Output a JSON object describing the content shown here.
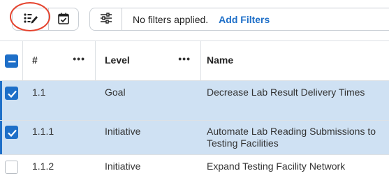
{
  "toolbar": {
    "view_buttons": [
      {
        "icon": "list-edit-icon",
        "active": true
      },
      {
        "icon": "calendar-check-icon",
        "active": false
      }
    ],
    "filter": {
      "icon": "sliders-icon",
      "status_text": "No filters applied.",
      "add_label": "Add Filters"
    }
  },
  "colors": {
    "accent": "#1e6fc8",
    "selected_row": "#cfe1f3",
    "annotation_ring": "#e5432e"
  },
  "table": {
    "headers": [
      {
        "label": "#",
        "menu": "•••"
      },
      {
        "label": "Level",
        "menu": "•••"
      },
      {
        "label": "Name"
      }
    ],
    "select_all_state": "indeterminate",
    "rows": [
      {
        "selected": true,
        "number": "1.1",
        "level": "Goal",
        "name": "Decrease Lab Result Delivery Times"
      },
      {
        "selected": true,
        "number": "1.1.1",
        "level": "Initiative",
        "name": "Automate Lab Reading Submissions to Testing Facilities"
      },
      {
        "selected": false,
        "number": "1.1.2",
        "level": "Initiative",
        "name": "Expand Testing Facility Network"
      }
    ]
  }
}
